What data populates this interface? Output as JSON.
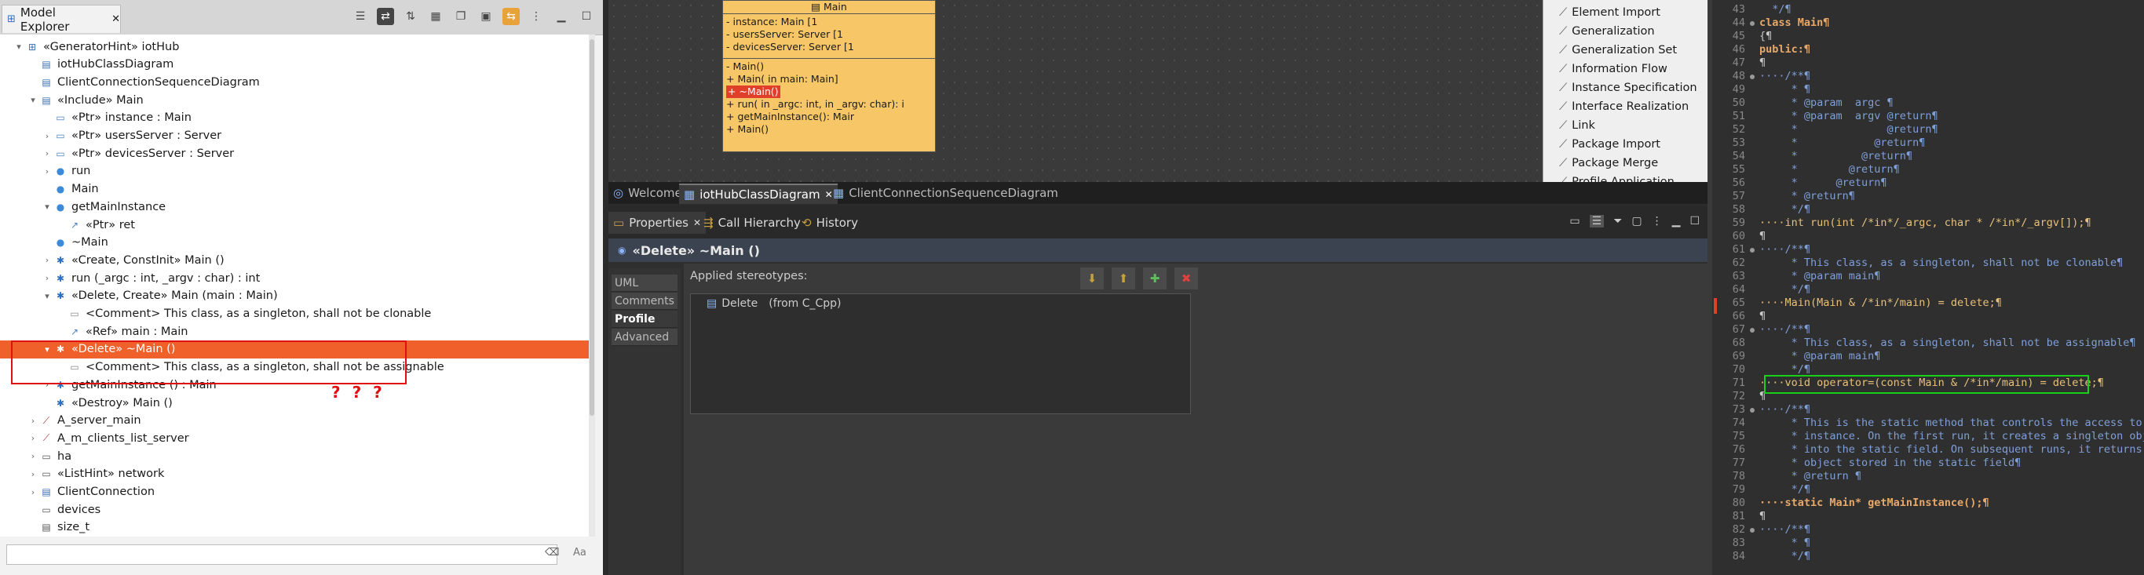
{
  "explorer": {
    "title": "Model Explorer",
    "tree": [
      {
        "indent": 0,
        "arrow": "▾",
        "icon": "model",
        "label": "«GeneratorHint» iotHub"
      },
      {
        "indent": 1,
        "arrow": "",
        "icon": "diagram",
        "label": "iotHubClassDiagram"
      },
      {
        "indent": 1,
        "arrow": "",
        "icon": "diagram",
        "label": "ClientConnectionSequenceDiagram"
      },
      {
        "indent": 1,
        "arrow": "▾",
        "icon": "class",
        "label": "«Include» Main"
      },
      {
        "indent": 2,
        "arrow": "",
        "icon": "property",
        "label": "«Ptr» instance : Main"
      },
      {
        "indent": 2,
        "arrow": "›",
        "icon": "property",
        "label": "«Ptr» usersServer : Server"
      },
      {
        "indent": 2,
        "arrow": "›",
        "icon": "property",
        "label": "«Ptr» devicesServer : Server"
      },
      {
        "indent": 2,
        "arrow": "›",
        "icon": "operation",
        "label": "run"
      },
      {
        "indent": 2,
        "arrow": "",
        "icon": "operation",
        "label": "Main"
      },
      {
        "indent": 2,
        "arrow": "▾",
        "icon": "operation",
        "label": "getMainInstance"
      },
      {
        "indent": 3,
        "arrow": "",
        "icon": "param",
        "label": "«Ptr» ret"
      },
      {
        "indent": 2,
        "arrow": "",
        "icon": "operation",
        "label": "~Main"
      },
      {
        "indent": 2,
        "arrow": "›",
        "icon": "gear",
        "label": "«Create, ConstInit» Main ()"
      },
      {
        "indent": 2,
        "arrow": "›",
        "icon": "gear",
        "label": "run (_argc : int, _argv : char) : int"
      },
      {
        "indent": 2,
        "arrow": "▾",
        "icon": "gear",
        "label": "«Delete, Create» Main (main : Main)"
      },
      {
        "indent": 3,
        "arrow": "",
        "icon": "comment",
        "label": "<Comment> This class, as a singleton, shall not be clonable"
      },
      {
        "indent": 3,
        "arrow": "",
        "icon": "param",
        "label": "«Ref» main : Main"
      },
      {
        "indent": 2,
        "arrow": "▾",
        "icon": "gear",
        "label": "«Delete» ~Main ()",
        "selected": true
      },
      {
        "indent": 3,
        "arrow": "",
        "icon": "comment",
        "label": "<Comment> This class, as a singleton, shall not be assignable"
      },
      {
        "indent": 2,
        "arrow": "›",
        "icon": "gear",
        "label": "getMainInstance () : Main"
      },
      {
        "indent": 2,
        "arrow": "",
        "icon": "gear",
        "label": "«Destroy» Main ()"
      },
      {
        "indent": 1,
        "arrow": "›",
        "icon": "interaction",
        "label": "A_server_main"
      },
      {
        "indent": 1,
        "arrow": "›",
        "icon": "interaction",
        "label": "A_m_clients_list_server"
      },
      {
        "indent": 1,
        "arrow": "›",
        "icon": "package",
        "label": "ha"
      },
      {
        "indent": 1,
        "arrow": "›",
        "icon": "package",
        "label": "«ListHint» network"
      },
      {
        "indent": 1,
        "arrow": "›",
        "icon": "class",
        "label": "ClientConnection"
      },
      {
        "indent": 1,
        "arrow": "",
        "icon": "package",
        "label": "devices"
      },
      {
        "indent": 1,
        "arrow": "",
        "icon": "datatype",
        "label": "size_t"
      }
    ],
    "annotation": "? ? ?",
    "filter_aa": "Aa"
  },
  "diagram": {
    "class_name": "Main",
    "attributes": [
      "- instance: Main [1",
      "- usersServer: Server [1",
      "- devicesServer: Server [1"
    ],
    "operations": [
      "- Main()",
      "+ Main(  in main: Main]",
      "+ ~Main()",
      "+ run(  in _argc: int,   in _argv: char): i",
      "+ getMainInstance(): Mair",
      "+ Main()"
    ]
  },
  "palette": {
    "items": [
      "Element Import",
      "Generalization",
      "Generalization Set",
      "Information Flow",
      "Instance Specification",
      "Interface Realization",
      "Link",
      "Package Import",
      "Package Merge",
      "Profile Application"
    ]
  },
  "editor_tabs": [
    {
      "label": "Welcome",
      "active": false
    },
    {
      "label": "iotHubClassDiagram",
      "active": true
    },
    {
      "label": "ClientConnectionSequenceDiagram",
      "active": false
    }
  ],
  "properties": {
    "tabs": [
      "Properties",
      "Call Hierarchy",
      "History"
    ],
    "title": "«Delete» ~Main ()",
    "side_tabs": [
      "UML",
      "Comments",
      "Profile",
      "Advanced"
    ],
    "applied_label": "Applied stereotypes:",
    "stereotype": "Delete",
    "stereotype_from": "(from C_Cpp)"
  },
  "code": {
    "lines": [
      {
        "n": "43",
        "t": "  */¶",
        "c": "cm"
      },
      {
        "n": "44",
        "t": "class Main¶",
        "c": "cls"
      },
      {
        "n": "45",
        "t": "{¶",
        "c": ""
      },
      {
        "n": "46",
        "t": "public:¶",
        "c": "kwline"
      },
      {
        "n": "47",
        "t": "¶",
        "c": ""
      },
      {
        "n": "48",
        "t": "····/**¶",
        "c": "cm"
      },
      {
        "n": "49",
        "t": "     * ¶",
        "c": "cm"
      },
      {
        "n": "50",
        "t": "     * @param  argc ¶",
        "c": "cm"
      },
      {
        "n": "51",
        "t": "     * @param  argv @return¶",
        "c": "cm"
      },
      {
        "n": "52",
        "t": "     *              @return¶",
        "c": "cm"
      },
      {
        "n": "53",
        "t": "     *            @return¶",
        "c": "cm"
      },
      {
        "n": "54",
        "t": "     *          @return¶",
        "c": "cm"
      },
      {
        "n": "55",
        "t": "     *        @return¶",
        "c": "cm"
      },
      {
        "n": "56",
        "t": "     *      @return¶",
        "c": "cm"
      },
      {
        "n": "57",
        "t": "     * @return¶",
        "c": "cm"
      },
      {
        "n": "58",
        "t": "     */¶",
        "c": "cm"
      },
      {
        "n": "59",
        "t": "····int run(int /*in*/_argc, char * /*in*/_argv[]);¶",
        "c": "run"
      },
      {
        "n": "60",
        "t": "¶",
        "c": ""
      },
      {
        "n": "61",
        "t": "····/**¶",
        "c": "cm"
      },
      {
        "n": "62",
        "t": "     * This class, as a singleton, shall not be clonable¶",
        "c": "cm"
      },
      {
        "n": "63",
        "t": "     * @param main¶",
        "c": "cm"
      },
      {
        "n": "64",
        "t": "     */¶",
        "c": "cm"
      },
      {
        "n": "65",
        "t": "····Main(Main & /*in*/main) = delete;¶",
        "c": "del"
      },
      {
        "n": "66",
        "t": "¶",
        "c": ""
      },
      {
        "n": "67",
        "t": "····/**¶",
        "c": "cm"
      },
      {
        "n": "68",
        "t": "     * This class, as a singleton, shall not be assignable¶",
        "c": "cm"
      },
      {
        "n": "69",
        "t": "     * @param main¶",
        "c": "cm"
      },
      {
        "n": "70",
        "t": "     */¶",
        "c": "cm"
      },
      {
        "n": "71",
        "t": "····void operator=(const Main & /*in*/main) = delete;¶",
        "c": "op"
      },
      {
        "n": "72",
        "t": "¶",
        "c": ""
      },
      {
        "n": "73",
        "t": "····/**¶",
        "c": "cm"
      },
      {
        "n": "74",
        "t": "     * This is the static method that controls the access to th",
        "c": "cm"
      },
      {
        "n": "75",
        "t": "     * instance. On the first run, it creates a singleton objec",
        "c": "cm"
      },
      {
        "n": "76",
        "t": "     * into the static field. On subsequent runs, it returns th",
        "c": "cm"
      },
      {
        "n": "77",
        "t": "     * object stored in the static field¶",
        "c": "cm"
      },
      {
        "n": "78",
        "t": "     * @return ¶",
        "c": "cm"
      },
      {
        "n": "79",
        "t": "     */¶",
        "c": "cm"
      },
      {
        "n": "80",
        "t": "····static Main* getMainInstance();¶",
        "c": "st"
      },
      {
        "n": "81",
        "t": "¶",
        "c": ""
      },
      {
        "n": "82",
        "t": "····/**¶",
        "c": "cm"
      },
      {
        "n": "83",
        "t": "     * ¶",
        "c": "cm"
      },
      {
        "n": "84",
        "t": "     */¶",
        "c": "cm"
      }
    ]
  },
  "colors": {
    "selection": "#f0602b",
    "highlight_red": "#e01010",
    "highlight_green": "#19d019",
    "uml_fill": "#f7c667"
  }
}
